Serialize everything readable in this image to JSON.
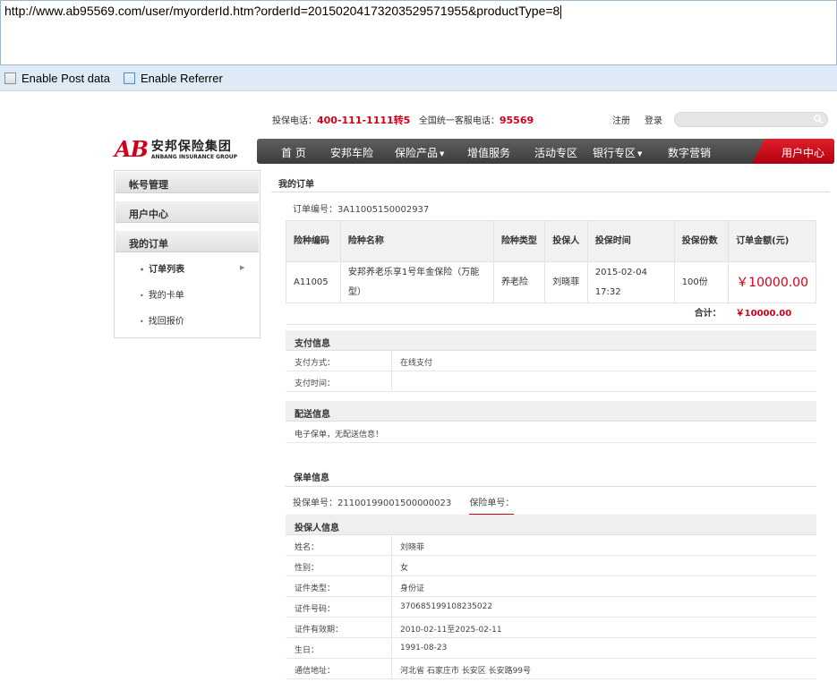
{
  "browser": {
    "url": "http://www.ab95569.com/user/myorderId.htm?orderId=20150204173203529571955&productType=8",
    "enable_post_data": "Enable Post data",
    "enable_referrer": "Enable Referrer"
  },
  "topbar": {
    "phone_label": "投保电话：",
    "phone": "400-111-1111转5",
    "service_label": "全国统一客服电话：",
    "service": "95569",
    "register": "注册",
    "login": "登录"
  },
  "logo": {
    "mark": "AB",
    "cn": "安邦保险集团",
    "en": "ANBANG INSURANCE GROUP"
  },
  "nav": {
    "items": [
      "首 页",
      "安邦车险",
      "保险产品",
      "增值服务",
      "活动专区",
      "银行专区",
      "数字营销"
    ],
    "user_center": "用户中心"
  },
  "sidebar": {
    "account": "帐号管理",
    "user_center": "用户中心",
    "my_orders": "我的订单",
    "sub": [
      "订单列表",
      "我的卡单",
      "找回报价"
    ]
  },
  "content": {
    "title": "我的订单",
    "order_no_label": "订单编号：",
    "order_no": "3A11005150002937",
    "table": {
      "headers": [
        "险种编码",
        "险种名称",
        "险种类型",
        "投保人",
        "投保时间",
        "投保份数",
        "订单金额(元)"
      ],
      "row": {
        "code": "A11005",
        "name": "安邦养老乐享1号年金保险（万能型）",
        "type": "养老险",
        "holder": "刘晓菲",
        "date": "2015-02-04",
        "time": "17:32",
        "count": "100份",
        "amount": "￥10000.00"
      },
      "total_label": "合计：",
      "total": "￥10000.00"
    },
    "payment": {
      "title": "支付信息",
      "method_label": "支付方式：",
      "method": "在线支付",
      "time_label": "支付时间："
    },
    "delivery": {
      "title": "配送信息",
      "note": "电子保单，无配送信息！"
    },
    "policy": {
      "title": "保单信息",
      "app_no_label": "投保单号：",
      "app_no": "21100199001500000023",
      "policy_no_label": "保险单号："
    },
    "holder_info": {
      "title": "投保人信息",
      "rows": [
        {
          "k": "姓名：",
          "v": "刘晓菲"
        },
        {
          "k": "性别：",
          "v": "女"
        },
        {
          "k": "证件类型：",
          "v": "身份证"
        },
        {
          "k": "证件号码：",
          "v": "370685199108235022"
        },
        {
          "k": "证件有效期：",
          "v": "2010-02-11至2025-02-11"
        },
        {
          "k": "生日：",
          "v": "1991-08-23"
        },
        {
          "k": "通信地址：",
          "v": "河北省 石家庄市 长安区 长安路99号"
        }
      ]
    }
  }
}
